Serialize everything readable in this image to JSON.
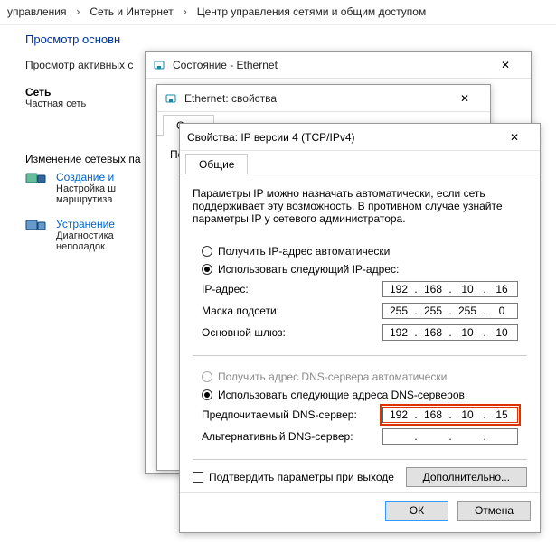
{
  "breadcrumb": {
    "a": "управления",
    "b": "Сеть и Интернет",
    "c": "Центр управления сетями и общим доступом"
  },
  "heading": "Просмотр основн",
  "sub_line": "Просмотр активных с",
  "chart_data": null,
  "sidebar": {
    "section1": {
      "h": "Сеть",
      "line": "Частная сеть"
    },
    "section2": {
      "h": "Изменение сетевых па"
    },
    "create": {
      "link": "Создание и",
      "l1": "Настройка ш",
      "l2": "маршрутиза"
    },
    "trouble": {
      "link": "Устранение",
      "l1": "Диагностика",
      "l2": "неполадок."
    }
  },
  "winStatus": {
    "title": "Состояние - Ethernet"
  },
  "winProps": {
    "title": "Ethernet: свойства",
    "tab": "Сеть",
    "label": "По"
  },
  "winIpv4": {
    "title": "Свойства: IP версии 4 (TCP/IPv4)",
    "tab": "Общие",
    "intro": "Параметры IP можно назначать автоматически, если сеть поддерживает эту возможность. В противном случае узнайте параметры IP у сетевого администратора.",
    "r_auto_ip": "Получить IP-адрес автоматически",
    "r_man_ip": "Использовать следующий IP-адрес:",
    "ip_label": "IP-адрес:",
    "mask_label": "Маска подсети:",
    "gw_label": "Основной шлюз:",
    "ip": {
      "a": "192",
      "b": "168",
      "c": "10",
      "d": "16"
    },
    "mask": {
      "a": "255",
      "b": "255",
      "c": "255",
      "d": "0"
    },
    "gw": {
      "a": "192",
      "b": "168",
      "c": "10",
      "d": "10"
    },
    "r_auto_dns": "Получить адрес DNS-сервера автоматически",
    "r_man_dns": "Использовать следующие адреса DNS-серверов:",
    "dns1_label": "Предпочитаемый DNS-сервер:",
    "dns2_label": "Альтернативный DNS-сервер:",
    "dns1": {
      "a": "192",
      "b": "168",
      "c": "10",
      "d": "15"
    },
    "dns2": {
      "a": "",
      "b": "",
      "c": "",
      "d": ""
    },
    "validate": "Подтвердить параметры при выходе",
    "advanced": "Дополнительно...",
    "ok": "ОК",
    "cancel": "Отмена"
  }
}
